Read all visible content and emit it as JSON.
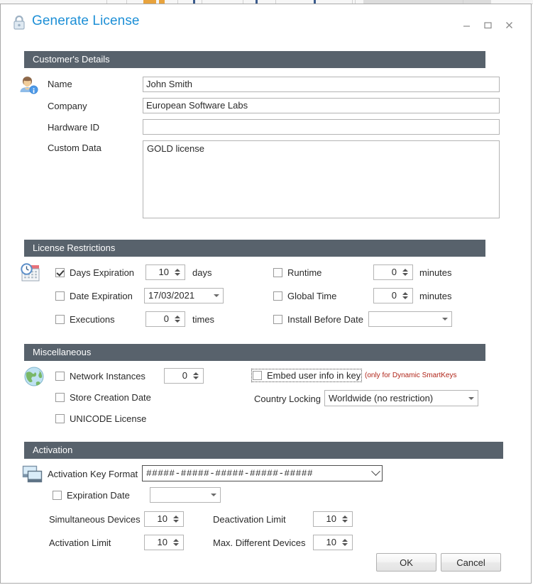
{
  "window": {
    "title": "Generate License",
    "lock_icon": "padlock-icon",
    "minimize_label": "Minimize",
    "maximize_label": "Maximize",
    "close_label": "Close",
    "accent_color": "#1d8fd6",
    "section_header_color": "#58626c"
  },
  "customer": {
    "header": "Customer's Details",
    "icon": "user-info-icon",
    "fields": [
      {
        "label": "Name",
        "value": "John Smith"
      },
      {
        "label": "Company",
        "value": "European Software Labs"
      },
      {
        "label": "Hardware ID",
        "value": ""
      },
      {
        "label": "Custom Data",
        "value": "GOLD license"
      }
    ]
  },
  "restrictions": {
    "header": "License Restrictions",
    "icon": "calendar-clock-icon",
    "days_expiration": {
      "label": "Days Expiration",
      "checked": true,
      "value": "10",
      "unit": "days"
    },
    "date_expiration": {
      "label": "Date Expiration",
      "checked": false,
      "value": "17/03/2021"
    },
    "executions": {
      "label": "Executions",
      "checked": false,
      "value": "0",
      "unit": "times"
    },
    "runtime": {
      "label": "Runtime",
      "checked": false,
      "value": "0",
      "unit": "minutes"
    },
    "global_time": {
      "label": "Global Time",
      "checked": false,
      "value": "0",
      "unit": "minutes"
    },
    "install_before_date": {
      "label": "Install Before Date",
      "checked": false,
      "value": ""
    }
  },
  "miscellaneous": {
    "header": "Miscellaneous",
    "icon": "globe-icon",
    "network_instances": {
      "label": "Network Instances",
      "checked": false,
      "value": "0"
    },
    "store_creation_date": {
      "label": "Store Creation Date",
      "checked": false
    },
    "unicode_license": {
      "label": "UNICODE License",
      "checked": false
    },
    "embed_user_info": {
      "label": "Embed user info in key",
      "checked": false,
      "focused": true
    },
    "embed_hint": "(only for Dynamic SmartKeys",
    "embed_hint_color": "#b02418",
    "country_locking": {
      "label": "Country Locking",
      "value": "Worldwide (no restriction)"
    }
  },
  "activation": {
    "header": "Activation",
    "icon": "windows-stack-icon",
    "key_format": {
      "label": "Activation Key Format",
      "value": "#####-#####-#####-#####-#####"
    },
    "expiration_date": {
      "label": "Expiration Date",
      "checked": false,
      "value": ""
    },
    "simultaneous_devices": {
      "label": "Simultaneous Devices",
      "value": "10"
    },
    "activation_limit": {
      "label": "Activation Limit",
      "value": "10"
    },
    "deactivation_limit": {
      "label": "Deactivation Limit",
      "value": "10"
    },
    "max_different_devices": {
      "label": "Max. Different Devices",
      "value": "10"
    }
  },
  "footer": {
    "ok_label": "OK",
    "cancel_label": "Cancel"
  }
}
